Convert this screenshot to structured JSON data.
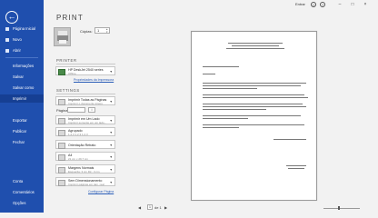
{
  "sidebar": {
    "items": [
      {
        "label": "Página Inicial"
      },
      {
        "label": "Novo"
      },
      {
        "label": "Abrir"
      },
      {
        "label": "Informações"
      },
      {
        "label": "Salvar"
      },
      {
        "label": "Salvar como"
      },
      {
        "label": "Imprimir"
      },
      {
        "label": "Exportar"
      },
      {
        "label": "Publicar"
      },
      {
        "label": "Fechar"
      },
      {
        "label": "Conta"
      },
      {
        "label": "Comentários"
      },
      {
        "label": "Opções"
      }
    ]
  },
  "topbar": {
    "user": "Entrar",
    "help": "?",
    "face": "☺",
    "win_min": "–",
    "win_max": "□",
    "win_close": "×"
  },
  "print": {
    "title": "Print",
    "copies_label": "Cópias:",
    "copies_value": "1"
  },
  "printer": {
    "section": "Printer",
    "name": "HP DeskJet 2540 series",
    "status": "Offline",
    "properties_link": "Propriedades da Impressora"
  },
  "settings": {
    "section": "Settings",
    "print_all": {
      "title": "Imprimir Todas as Páginas",
      "sub": "Imprimir o documento inteiro"
    },
    "pages_label": "Páginas:",
    "sides": {
      "title": "Imprimir em Um Lado",
      "sub": "Imprimir somente em um lado..."
    },
    "collated": {
      "title": "Agrupado",
      "sub": "1,2,3   1,2,3   1,2,3"
    },
    "orientation": {
      "title": "Orientação Retrato",
      "sub": ""
    },
    "paper": {
      "title": "A4",
      "sub": "21 cm x 29,7 cm"
    },
    "margins": {
      "title": "Margens Normais",
      "sub": "Esquerda: 3 cm   Dir.: 3 cm"
    },
    "scaling": {
      "title": "Sem Dimensionamento",
      "sub": "Imprimir páginas em tam. real"
    },
    "page_setup_link": "Configurar Página"
  },
  "pager": {
    "current": "1",
    "of_text": "de 1",
    "prev": "◀",
    "next": "▶"
  }
}
